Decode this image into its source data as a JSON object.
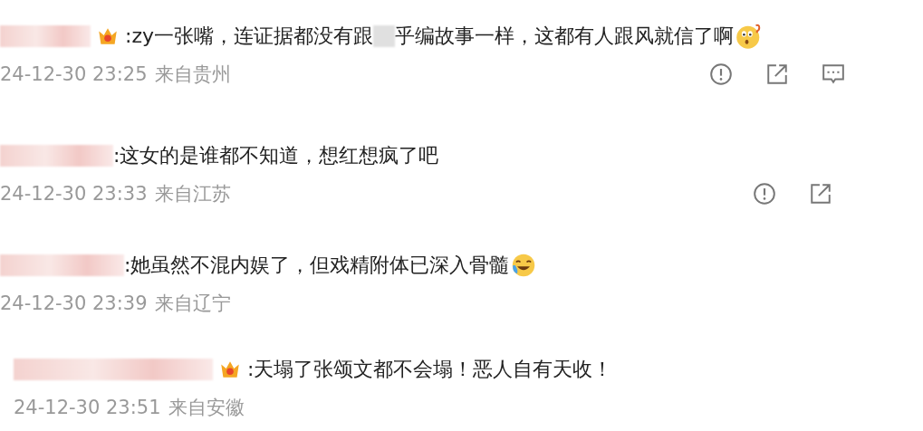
{
  "comments": [
    {
      "badge": true,
      "text_parts": [
        ":zy一张嘴，连证据都没有跟",
        "乎编故事一样，这都有人跟风就信了啊"
      ],
      "emoji": {
        "kind": "surprised"
      },
      "time": "24-12-30 23:25",
      "location": "来自贵州",
      "actions": [
        {
          "kind": "report"
        },
        {
          "kind": "share"
        },
        {
          "kind": "comment"
        }
      ]
    },
    {
      "badge": false,
      "text_parts": [
        ":这女的是谁都不知道，想红想疯了吧"
      ],
      "time": "24-12-30 23:33",
      "location": "来自江苏",
      "actions": [
        {
          "kind": "report"
        },
        {
          "kind": "share"
        }
      ]
    },
    {
      "badge": false,
      "text_parts": [
        ":她虽然不混内娱了，但戏精附体已深入骨髓"
      ],
      "emoji": {
        "kind": "laugh-cry"
      },
      "time": "24-12-30 23:39",
      "location": "来自辽宁"
    },
    {
      "badge": true,
      "text_parts": [
        ":天塌了张颂文都不会塌！恶人自有天收！"
      ],
      "time": "24-12-30 23:51",
      "location": "来自安徽"
    }
  ]
}
